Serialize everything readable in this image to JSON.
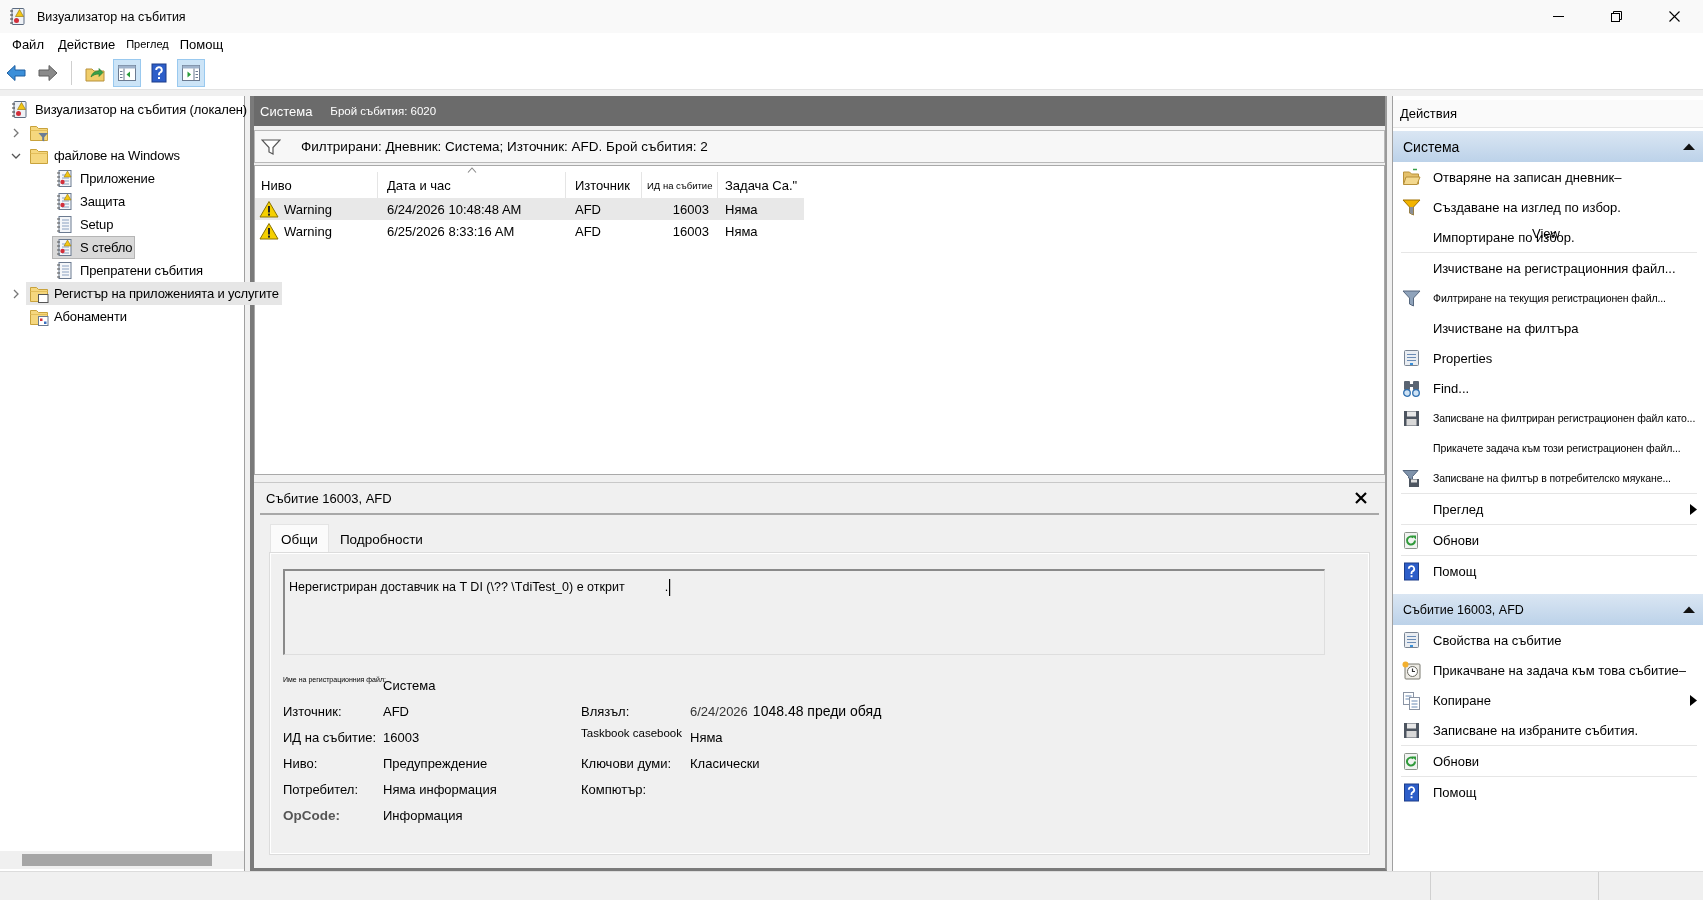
{
  "window": {
    "title": "Визуализатор на събития"
  },
  "menu": [
    "Файл",
    "Действие",
    "Преглед",
    "Помощ"
  ],
  "toolbar": [
    {
      "kind": "back",
      "on": false
    },
    {
      "kind": "forward",
      "on": false
    },
    {
      "kind": "separator"
    },
    {
      "kind": "up",
      "on": false
    },
    {
      "kind": "tree",
      "on": true
    },
    {
      "kind": "help",
      "on": false
    },
    {
      "kind": "actions",
      "on": true
    }
  ],
  "tree": {
    "label": "Визуализатор на събития (локален)",
    "kind": "viewer",
    "selected": false,
    "hovered": false,
    "children": [
      {
        "kind": "views",
        "expanded": false,
        "selected": false,
        "hovered": false
      },
      {
        "label": "файлове на Windows",
        "kind": "folder",
        "expanded": true,
        "selected": false,
        "hovered": false,
        "children": [
          {
            "label": "Приложение",
            "kind": "log",
            "selected": false,
            "hovered": false
          },
          {
            "label": "Защита",
            "kind": "log",
            "selected": false,
            "hovered": false
          },
          {
            "label": "Setup",
            "kind": "plain",
            "selected": false,
            "hovered": false
          },
          {
            "label": "S стебло",
            "kind": "log",
            "selected": true,
            "hovered": false
          },
          {
            "label": "Препратени събития",
            "kind": "plain",
            "selected": false,
            "hovered": false
          }
        ]
      },
      {
        "label": "Регистър на приложенията и услугите",
        "kind": "services",
        "expanded": false,
        "selected": false,
        "hovered": true
      },
      {
        "label": "Абонаменти",
        "kind": "subscriptions",
        "selected": false,
        "hovered": false
      }
    ]
  },
  "log_header": {
    "name": "Система",
    "count": "Брой събития: 6020"
  },
  "filter_bar": {
    "text": "Филтрирани: Дневник: Система; Източник: AFD. Брой събития: 2"
  },
  "events": {
    "columns": [
      {
        "label": "Ниво",
        "sorted": false
      },
      {
        "label": "Дата и час",
        "sorted": true
      },
      {
        "label": "Източник",
        "sorted": false
      },
      {
        "label": "ИД на събитие",
        "sorted": false
      },
      {
        "label": "Задача Са.\"",
        "sorted": false
      }
    ],
    "rows": [
      {
        "kind": "warning",
        "selected": true,
        "cells": [
          "Warning",
          "6/24/2026 10:48:48 AM",
          "AFD",
          "16003",
          "Няма"
        ]
      },
      {
        "kind": "warning",
        "selected": false,
        "cells": [
          "Warning",
          "6/25/2026 8:33:16 AM",
          "AFD",
          "16003",
          "Няма"
        ]
      }
    ]
  },
  "detail": {
    "title": "Събитие 16003, AFD",
    "tabs": [
      {
        "label": "Общи",
        "selected": true
      },
      {
        "label": "Подробности",
        "selected": false
      }
    ],
    "message": {
      "text": "Нерегистриран доставчик на T DI (\\?? \\TdiTest_0) е открит",
      "tail": "."
    },
    "field_rows": [
      {
        "left": {
          "label": "Име на регистрационния файл:",
          "value": "Система"
        }
      },
      {
        "left": {
          "label": "Източник:",
          "value": "AFD"
        },
        "right": {
          "label": "Влязъл:",
          "value": "6/24/2026",
          "value_2": "1048.48 преди обяд"
        }
      },
      {
        "left": {
          "label": "ИД на събитие:",
          "value": "16003"
        },
        "right": {
          "label": "Taskbook casebook",
          "value": "Няма"
        }
      },
      {
        "left": {
          "label": "Ниво:",
          "value": "Предупреждение"
        },
        "right": {
          "label": "Ключови думи:",
          "value": "Класически"
        }
      },
      {
        "left": {
          "label": "Потребител:",
          "value": "Няма информация"
        },
        "right": {
          "label": "Компютър:"
        }
      },
      {
        "left": {
          "label": "OpCode:",
          "value": "Информация"
        }
      }
    ]
  },
  "actions": {
    "title": "Действия",
    "sections": [
      {
        "title": "Система",
        "expanded": true,
        "items": [
          {
            "kind": "open",
            "label": "Отваряне на записан дневник–",
            "submenu": false
          },
          {
            "kind": "newview",
            "label": "Създаване на изглед по избор.",
            "submenu": false
          },
          {
            "kind": "plain",
            "label": "Импортиране по избор.",
            "overlay": "View",
            "submenu": false
          },
          {
            "kind": "separator"
          },
          {
            "kind": "plain",
            "label": "Изчистване на регистрационния файл...",
            "submenu": false
          },
          {
            "kind": "filter",
            "label": "Филтриране на текущия регистрационен файл...",
            "submenu": false
          },
          {
            "kind": "plain",
            "label": "Изчистване на филтъра",
            "submenu": false
          },
          {
            "kind": "properties",
            "label": "Properties",
            "submenu": false
          },
          {
            "kind": "find",
            "label": "Find...",
            "submenu": false
          },
          {
            "kind": "save",
            "label": "Записване на филтриран регистрационен файл като...",
            "submenu": false
          },
          {
            "kind": "plain",
            "label": "Прикачете задача към този регистрационен файл...",
            "submenu": false
          },
          {
            "kind": "savefilter",
            "label": "Записване на филтър в потребителско мяукане...",
            "submenu": false
          },
          {
            "kind": "separator"
          },
          {
            "kind": "plain",
            "label": "Преглед",
            "submenu": true
          },
          {
            "kind": "separator"
          },
          {
            "kind": "refresh",
            "label": "Обнови",
            "submenu": false
          },
          {
            "kind": "separator"
          },
          {
            "kind": "help",
            "label": "Помощ",
            "submenu": false
          }
        ]
      },
      {
        "title": "Събитие 16003, AFD",
        "expanded": true,
        "items": [
          {
            "kind": "properties",
            "label": "Свойства на събитие",
            "submenu": false
          },
          {
            "kind": "task",
            "label": "Прикачване на задача към това събитие–",
            "submenu": false
          },
          {
            "kind": "copy",
            "label": "Копиране",
            "submenu": true
          },
          {
            "kind": "save",
            "label": "Записване на избраните събития.",
            "submenu": false
          },
          {
            "kind": "separator"
          },
          {
            "kind": "refresh",
            "label": "Обнови",
            "submenu": false
          },
          {
            "kind": "separator"
          },
          {
            "kind": "help",
            "label": "Помощ",
            "submenu": false
          }
        ]
      }
    ]
  }
}
